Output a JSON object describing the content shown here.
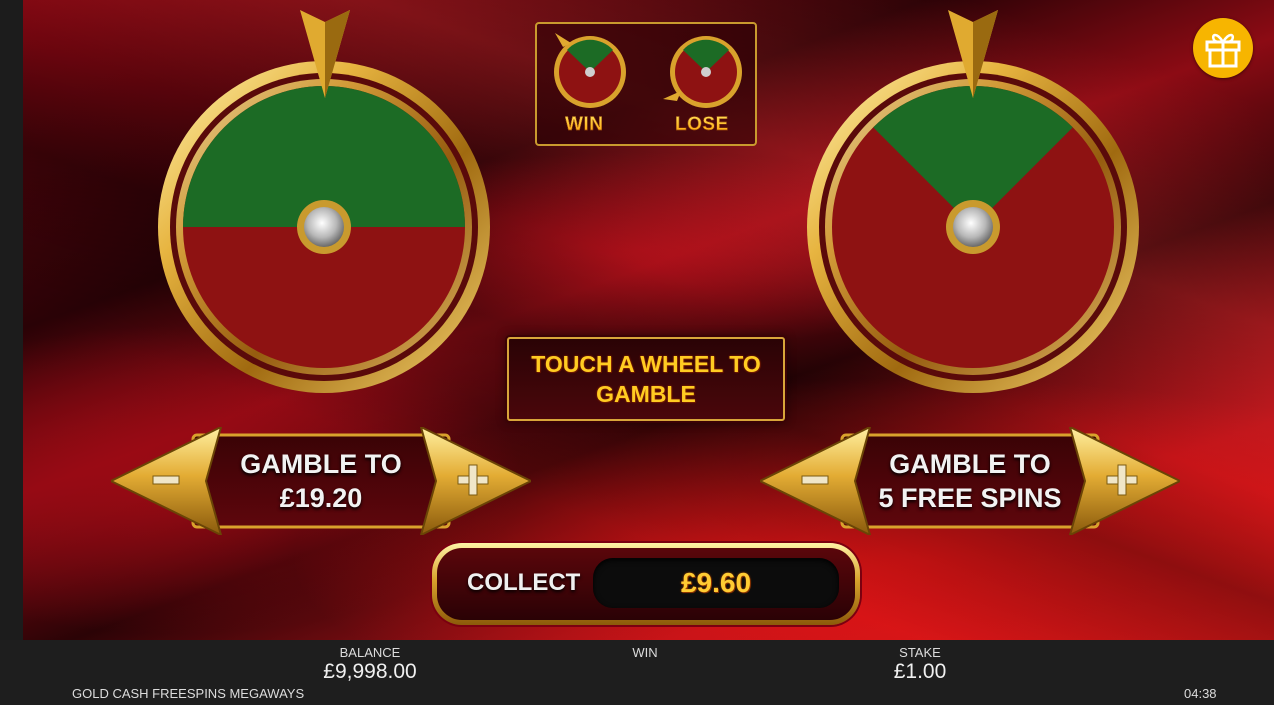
{
  "legend": {
    "win_label": "WIN",
    "lose_label": "LOSE"
  },
  "prompt": {
    "text": "TOUCH A WHEEL TO GAMBLE"
  },
  "gamble_cash": {
    "line1": "GAMBLE TO",
    "line2": "£19.20"
  },
  "gamble_spins": {
    "line1": "GAMBLE TO",
    "line2": "5 FREE SPINS"
  },
  "collect": {
    "label": "COLLECT",
    "amount": "£9.60"
  },
  "footer": {
    "balance_label": "BALANCE",
    "balance_value": "£9,998.00",
    "win_label": "WIN",
    "stake_label": "STAKE",
    "stake_value": "£1.00",
    "game_name": "GOLD CASH FREESPINS MEGAWAYS",
    "clock": "04:38"
  },
  "colors": {
    "win_green": "#1c6b25",
    "lose_red": "#8e1212",
    "gold": "#d9a22c",
    "gift": "#f7b500"
  },
  "icons": [
    "pointer-icon",
    "minus-icon",
    "plus-icon",
    "gift-icon"
  ]
}
